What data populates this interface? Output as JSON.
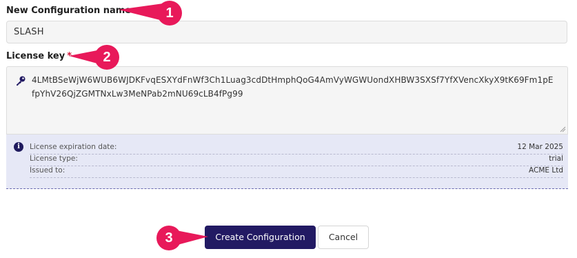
{
  "form": {
    "config_name_label": "New Configuration name",
    "config_name_value": "SLASH",
    "license_key_label": "License key",
    "required_marker": "*",
    "license_key_value": "4LMtBSeWjW6WUB6WJDKFvqESXYdFnWf3Ch1Luag3cdDtHmphQoG4AmVyWGWUondXHBW3SXSf7YfXVencXkyX9tK69Fm1pEfpYhV26QjZGMTNxLw3MeNPab2mNU69cLB4fPg99"
  },
  "license_info": {
    "rows": [
      {
        "key": "License expiration date:",
        "value": "12 Mar 2025"
      },
      {
        "key": "License type:",
        "value": "trial"
      },
      {
        "key": "Issued to:",
        "value": "ACME Ltd"
      }
    ]
  },
  "actions": {
    "create_label": "Create Configuration",
    "cancel_label": "Cancel"
  },
  "callouts": [
    "1",
    "2",
    "3"
  ],
  "colors": {
    "primary": "#221a63",
    "callout": "#e8195a",
    "info_bg": "#e6e8f6",
    "required": "#d2143a"
  },
  "icons": [
    "key-icon",
    "info-icon",
    "resize-grip-icon"
  ]
}
